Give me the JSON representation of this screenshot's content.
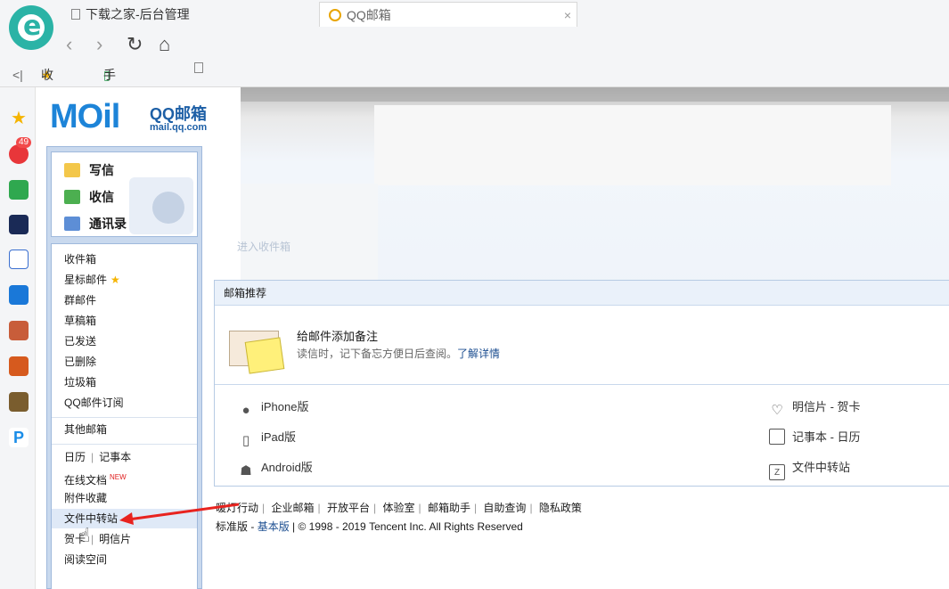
{
  "browser": {
    "tab1_title": "下载之家-后台管理",
    "tab2_title": "QQ邮箱",
    "tab_close": "×",
    "bookmarks": [
      "收藏",
      "手机收藏夹"
    ],
    "collapse_glyph": "<|"
  },
  "sidebar": {
    "weibo_badge": "49"
  },
  "logo": {
    "moil": "MOil",
    "title": "QQ邮箱",
    "domain": "mail.qq.com"
  },
  "commands": {
    "compose": "写信",
    "inbox": "收信",
    "contacts": "通讯录"
  },
  "folders": {
    "group1": [
      "收件箱",
      "星标邮件",
      "群邮件",
      "草稿箱",
      "已发送",
      "已删除",
      "垃圾箱",
      "QQ邮件订阅"
    ],
    "other": "其他邮箱",
    "calendar": "日历",
    "notebook": "记事本",
    "online_docs": "在线文档",
    "new_tag": "NEW",
    "attachments": "附件收藏",
    "file_transfer": "文件中转站",
    "greeting": "贺卡",
    "postcard": "明信片",
    "reading": "阅读空间"
  },
  "blurred_text": "进入收件箱",
  "recommend": {
    "header": "邮箱推荐",
    "tip_title": "给邮件添加备注",
    "tip_desc": "读信时，记下备忘方便日后查阅。",
    "tip_link": "了解详情",
    "apps_left": [
      "iPhone版",
      "iPad版",
      "Android版"
    ],
    "apps_right": [
      "明信片 - 贺卡",
      "记事本 - 日历",
      "文件中转站"
    ]
  },
  "footer": {
    "links": [
      "暖灯行动",
      "企业邮箱",
      "开放平台",
      "体验室",
      "邮箱助手",
      "自助查询",
      "隐私政策"
    ],
    "standard": "标准版",
    "basic": "基本版",
    "copyright": "© 1998 - 2019 Tencent Inc. All Rights Reserved"
  },
  "colors": {
    "accent": "#1d84d8",
    "panel_bg": "#c9d9ee",
    "arrow": "#e8231f"
  }
}
